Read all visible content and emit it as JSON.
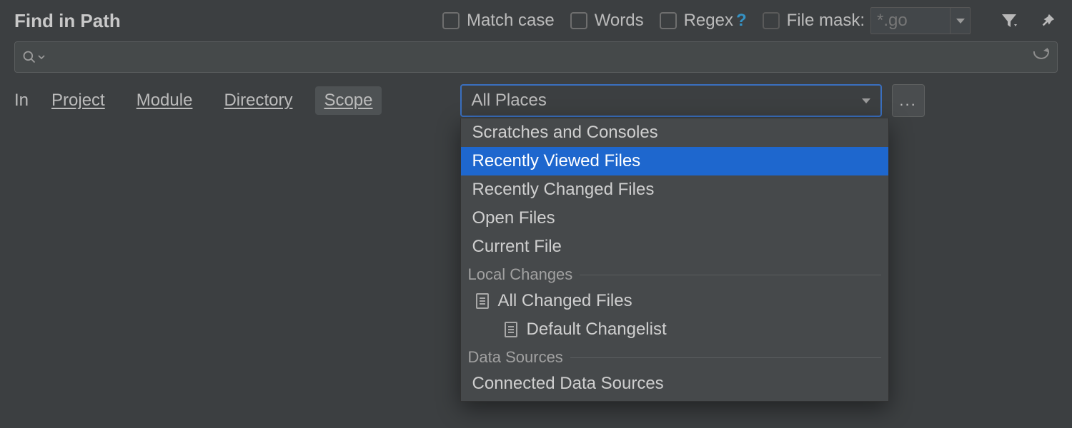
{
  "dialog": {
    "title": "Find in Path",
    "options": {
      "match_case": "Match case",
      "words": "Words",
      "regex": "Regex",
      "regex_help": "?",
      "file_mask_label": "File mask:",
      "file_mask_value": "*.go"
    },
    "search": {
      "value": "",
      "placeholder": ""
    },
    "tabs": {
      "label": "In",
      "project": "Project",
      "module": "Module",
      "directory": "Directory",
      "scope": "Scope"
    },
    "scope": {
      "selected": "All Places",
      "ellipsis": "..."
    },
    "dropdown": {
      "items_top": [
        "Scratches and Consoles",
        "Recently Viewed Files",
        "Recently Changed Files",
        "Open Files",
        "Current File"
      ],
      "highlight_index": 1,
      "group_local_changes": "Local Changes",
      "all_changed_files": "All Changed Files",
      "default_changelist": "Default Changelist",
      "group_data_sources": "Data Sources",
      "connected_ds": "Connected Data Sources"
    }
  }
}
